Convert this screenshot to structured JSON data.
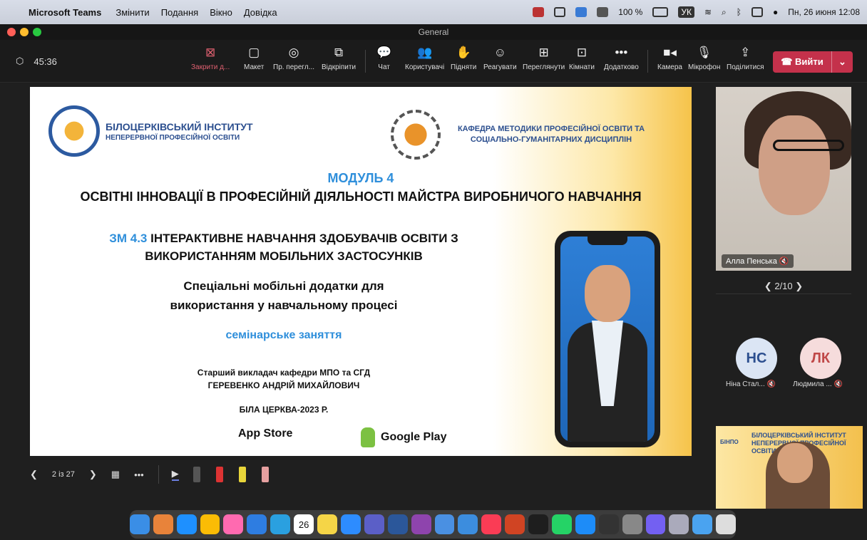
{
  "menubar": {
    "app": "Microsoft Teams",
    "items": [
      "Змінити",
      "Подання",
      "Вікно",
      "Довідка"
    ],
    "battery": "100 %",
    "lang": "УК",
    "datetime": "Пн, 26 июня 12:08"
  },
  "window": {
    "title": "General"
  },
  "toolbar": {
    "timer": "45:36",
    "close": "Закрити д...",
    "layout": "Макет",
    "preview": "Пр. перегл...",
    "popout": "Відкріпити",
    "chat": "Чат",
    "people": "Користувачі",
    "raise": "Підняти",
    "react": "Реагувати",
    "view": "Переглянути",
    "rooms": "Кімнати",
    "more": "Додатково",
    "camera": "Камера",
    "mic": "Мікрофон",
    "share": "Поділитися",
    "leave": "Вийти"
  },
  "slide": {
    "inst_line1": "БІЛОЦЕРКІВСЬКИЙ ІНСТИТУТ",
    "inst_line2": "НЕПЕРЕРВНОЇ ПРОФЕСІЙНОЇ ОСВІТИ",
    "dept_line1": "КАФЕДРА МЕТОДИКИ ПРОФЕСІЙНОЇ ОСВІТИ ТА",
    "dept_line2": "СОЦІАЛЬНО-ГУМАНІТАРНИХ ДИСЦИПЛІН",
    "module": "МОДУЛЬ 4",
    "module_title": "ОСВІТНІ ІННОВАЦІЇ В ПРОФЕСІЙНІЙ ДІЯЛЬНОСТІ МАЙСТРА ВИРОБНИЧОГО НАВЧАННЯ",
    "zm_code": "ЗМ 4.3",
    "zm_line1": "ІНТЕРАКТИВНЕ НАВЧАННЯ ЗДОБУВАЧІВ ОСВІТИ З",
    "zm_line2": "ВИКОРИСТАННЯМ МОБІЛЬНИХ ЗАСТОСУНКІВ",
    "spec_line1": "Спеціальні мобільні додатки для",
    "spec_line2": "використання у навчальному процесі",
    "seminar": "семінарське заняття",
    "lecturer_line1": "Старший викладач кафедри МПО та СГД",
    "lecturer_line2": "ГЕРЕВЕНКО АНДРІЙ МИХАЙЛОВИЧ",
    "city": "БІЛА ЦЕРКВА-2023 Р.",
    "appstore": "App Store",
    "googleplay": "Google Play"
  },
  "slide_controls": {
    "page": "2 із 27"
  },
  "participants": {
    "main_name": "Алла Пенська",
    "pager": "2/10",
    "p1_initials": "НС",
    "p1_name": "Ніна Стал...",
    "p2_initials": "ЛК",
    "p2_name": "Людмила ...",
    "p1_color": "#dbe5f4",
    "p2_color": "#f6dcdc"
  },
  "presenter_slide": {
    "line1": "БІЛОЦЕРКІВСЬКИЙ ІНСТИТУТ",
    "line2": "НЕПЕРЕРВНОЇ ПРОФЕСІЙНОЇ ОСВІТИ",
    "logo_text": "БІНПО"
  },
  "dock": {
    "calendar_day": "26",
    "calendar_month": "ИЮНЬ"
  },
  "colors": {
    "accent": "#2f8fdb",
    "leave": "#c4314b"
  }
}
